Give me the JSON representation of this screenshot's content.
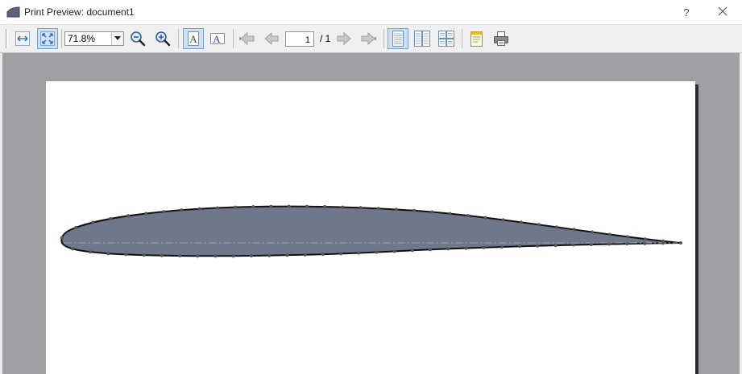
{
  "window": {
    "title": "Print Preview: document1",
    "help_label": "?",
    "icons": {
      "app": "print-preview-app-icon",
      "close": "close-icon"
    }
  },
  "toolbar": {
    "zoom": {
      "value": "71.8%"
    },
    "page": {
      "current": "1",
      "total_label": "/ 1"
    },
    "buttons": [
      "fit-width-icon",
      "fit-page-icon",
      "zoom-out-icon",
      "zoom-in-icon",
      "portrait-icon",
      "landscape-icon",
      "first-page-icon",
      "previous-page-icon",
      "next-page-icon",
      "last-page-icon",
      "single-page-icon",
      "two-pages-icon",
      "multi-page-icon",
      "page-setup-icon",
      "print-icon"
    ]
  },
  "document": {
    "shape": "airfoil profile",
    "colors": {
      "fill": "#6f778a",
      "outline": "#111111",
      "marker": "#555555",
      "chord_line": "#9aa0ac"
    }
  }
}
